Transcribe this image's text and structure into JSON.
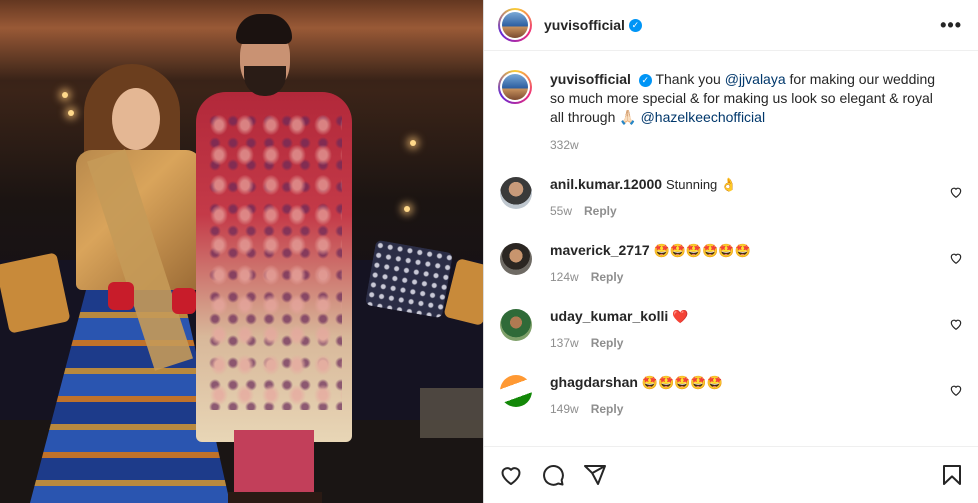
{
  "post": {
    "author": "yuvisofficial",
    "verified_mark": "✓"
  },
  "header": {
    "username": "yuvisofficial",
    "more_label": "•••"
  },
  "caption": {
    "username": "yuvisofficial",
    "text_1": "Thank you ",
    "mention_1": "@jjvalaya",
    "text_2": " for making our wedding so much more special & for making us look so elegant & royal all through 🙏🏻 ",
    "mention_2": "@hazelkeechofficial",
    "age": "332w"
  },
  "comments": [
    {
      "username": "anil.kumar.12000",
      "text": "Stunning 👌",
      "age": "55w",
      "reply_label": "Reply"
    },
    {
      "username": "maverick_2717",
      "text": "🤩🤩🤩🤩🤩🤩",
      "age": "124w",
      "reply_label": "Reply"
    },
    {
      "username": "uday_kumar_kolli",
      "text": "❤️",
      "age": "137w",
      "reply_label": "Reply"
    },
    {
      "username": "ghagdarshan",
      "text": "🤩🤩🤩🤩🤩",
      "age": "149w",
      "reply_label": "Reply"
    }
  ],
  "icons": {
    "like": "heart-icon",
    "comment": "comment-icon",
    "share": "share-icon",
    "save": "bookmark-icon"
  },
  "colors": {
    "verified": "#0095f6",
    "mention": "#00376b",
    "muted": "#8e8e8e"
  }
}
